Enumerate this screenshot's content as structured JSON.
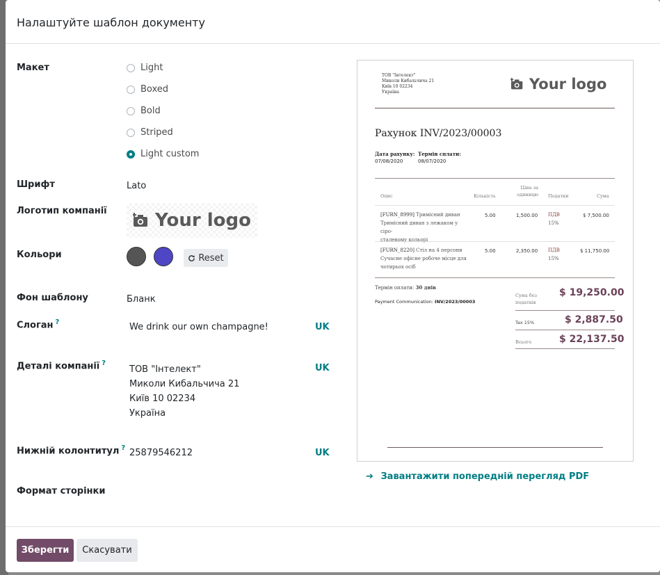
{
  "title": "Налаштуйте шаблон документу",
  "layout": {
    "label": "Макет",
    "options": [
      "Light",
      "Boxed",
      "Bold",
      "Striped",
      "Light custom"
    ],
    "selected": "Light custom"
  },
  "font": {
    "label": "Шрифт",
    "value": "Lato"
  },
  "logo": {
    "label": "Логотип компанії",
    "text": "Your logo"
  },
  "colors": {
    "label": "Кольори",
    "primary": "#555555",
    "secondary": "#4f46c6",
    "reset_label": "Reset"
  },
  "background": {
    "label": "Фон шаблону",
    "value": "Бланк"
  },
  "tagline": {
    "label": "Слоган",
    "help": "?",
    "value": "We drink our own champagne!",
    "lang": "UK"
  },
  "company_details": {
    "label": "Деталі компанії",
    "help": "?",
    "lang": "UK",
    "lines": [
      "ТОВ \"Інтелект\"",
      "Миколи Кибальчича 21",
      "Київ 10 02234",
      "Україна"
    ]
  },
  "footer": {
    "label": "Нижній колонтитул",
    "help": "?",
    "value": "25879546212",
    "lang": "UK"
  },
  "paper_format": {
    "label": "Формат сторінки"
  },
  "preview": {
    "address": [
      "ТОВ \"Інтелект\"",
      "Миколи Кибальчича 21",
      "Київ 10 02234",
      "Україна"
    ],
    "logo_text": "Your logo",
    "invoice_title": "Рахунок INV/2023/00003",
    "invoice_date_label": "Дата рахунку:",
    "invoice_date": "07/08/2020",
    "due_date_label": "Термін сплати:",
    "due_date": "08/07/2020",
    "columns": {
      "description": "Опис",
      "quantity": "Кількість",
      "price_l1": "Ціна за",
      "price_l2": "одиницю",
      "taxes": "Податки",
      "amount": "Сума"
    },
    "lines": [
      {
        "code": "[FURN_8999]",
        "desc1": "Тримісний диван",
        "desc2": "Тримісний диван з лежаком у сіро-",
        "desc3": "сталевому кольорі",
        "qty": "5.00",
        "price": "1,500.00",
        "tax1": "ПДВ",
        "tax2": "15%",
        "amount": "$ 7,500.00"
      },
      {
        "code": "[FURN_8220]",
        "desc1": "Стіл на 4 персони",
        "desc2": "Сучасне офісне робоче місце для",
        "desc3": "чотирьох осіб",
        "qty": "5.00",
        "price": "2,350.00",
        "tax1": "ПДВ",
        "tax2": "15%",
        "amount": "$ 11,750.00"
      }
    ],
    "payment_terms_label": "Термін оплати:",
    "payment_terms": "30 днів",
    "payment_comm_label": "Payment Communication:",
    "payment_comm": "INV/2023/00003",
    "untaxed_label_1": "Сума без",
    "untaxed_label_2": "податків",
    "untaxed": "$ 19,250.00",
    "tax_label": "Tax 15%",
    "tax": "$ 2,887.50",
    "total_label": "Всього",
    "total": "$ 22,137.50"
  },
  "pdf_link": {
    "arrow": "➔",
    "label": "Завантажити попередній перегляд PDF"
  },
  "buttons": {
    "save": "Зберегти",
    "cancel": "Скасувати"
  }
}
